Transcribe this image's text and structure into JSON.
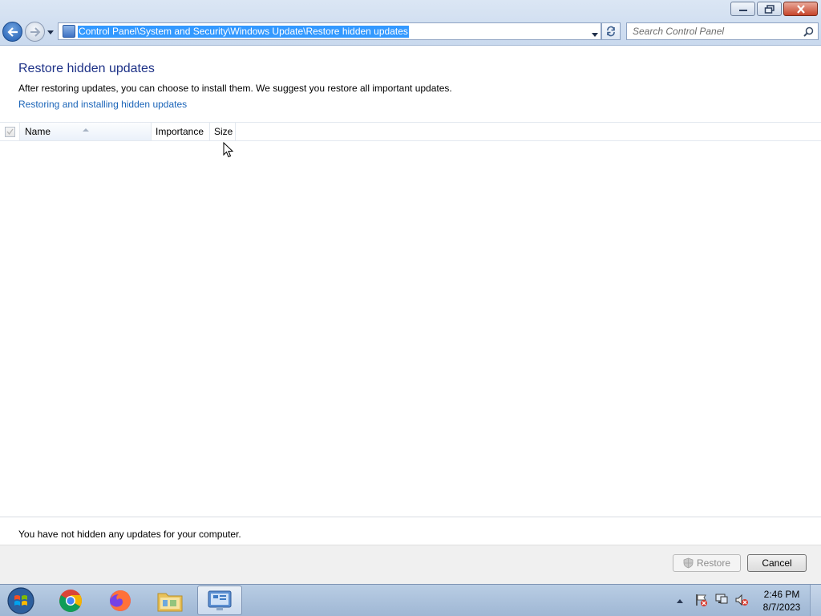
{
  "window": {
    "controls": {
      "minimize": "minimize",
      "maximize": "restore-down",
      "close": "close"
    }
  },
  "nav": {
    "address_path": "Control Panel\\System and Security\\Windows Update\\Restore hidden updates",
    "search_placeholder": "Search Control Panel"
  },
  "main": {
    "title": "Restore hidden updates",
    "description": "After restoring updates, you can choose to install them. We suggest you restore all important updates.",
    "help_link": "Restoring and installing hidden updates",
    "columns": [
      "Name",
      "Importance",
      "Size"
    ],
    "rows": [],
    "status": "You have not hidden any updates for your computer."
  },
  "footer": {
    "restore_label": "Restore",
    "cancel_label": "Cancel"
  },
  "taskbar": {
    "apps": [
      "start-orb",
      "chrome",
      "firefox",
      "file-explorer",
      "control-panel"
    ],
    "time": "2:46 PM",
    "date": "8/7/2023"
  },
  "colors": {
    "title_blue": "#1e3287",
    "link_blue": "#1a64b8",
    "selection_blue": "#3399ff"
  }
}
